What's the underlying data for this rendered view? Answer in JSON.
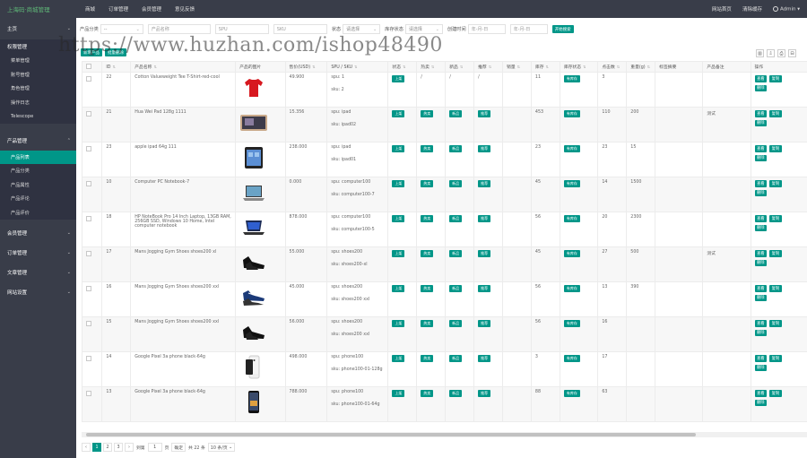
{
  "topbar": {
    "brand": "上海码·商城管理",
    "nav": [
      "商城",
      "订单管理",
      "会员管理",
      "意见反馈"
    ],
    "right": [
      "网站首页",
      "清除缓存"
    ],
    "user": "Admin"
  },
  "sidebar": {
    "home": "主页",
    "sec1": "权限管理",
    "sec1_items": [
      "菜单管理",
      "账号管理",
      "角色管理",
      "操作日志",
      "Telescope"
    ],
    "sec2": "产品管理",
    "sec2_items": [
      "产品列表",
      "产品分类",
      "产品属性",
      "产品评论",
      "产品评价"
    ],
    "sec3": "会员管理",
    "sec4": "订单管理",
    "sec5": "文章管理",
    "sec6": "网站设置"
  },
  "filter": {
    "cat_label": "产品分类",
    "cat_value": "--",
    "name_placeholder": "产品名称",
    "spu_placeholder": "SPU",
    "sku_placeholder": "SKU",
    "status_label": "状态",
    "status_value": "请选择",
    "stock_label": "库存状态",
    "stock_value": "请选择",
    "time_label": "创建时间",
    "from_placeholder": "年-月-日",
    "to_placeholder": "年-月-日",
    "search_btn": "开始搜索"
  },
  "actions": {
    "add": "新增产品",
    "batch": "批量删除"
  },
  "watermark": "https://www.huzhan.com/ishop48490",
  "table": {
    "headers": [
      "ID",
      "产品名称",
      "产品的图片",
      "售价(USD)",
      "SPU / SKU",
      "状态",
      "热卖",
      "新品",
      "推荐",
      "销量",
      "库存",
      "库存状态",
      "点击数",
      "重量(g)",
      "标签摘要",
      "产品备注",
      "操作"
    ],
    "rows": [
      {
        "id": "22",
        "name": "Cotton Valueweight Tee T-Shirt-red-cool",
        "pic": "tshirt",
        "price": "49.900",
        "spu": "spu: 1",
        "sku": "sku: 2",
        "status": "上架",
        "hot": "/",
        "new": "/",
        "rec": "/",
        "sales": "",
        "stock": "11",
        "stock_status": "有库存",
        "clicks": "3",
        "weight": "",
        "note": ""
      },
      {
        "id": "21",
        "name": "Hua Wei Pad 128g 1111",
        "pic": "tablet",
        "price": "15.356",
        "spu": "spu: ipad",
        "sku": "sku: ipad02",
        "status": "上架",
        "hot": "热卖",
        "new": "新品",
        "rec": "推荐",
        "sales": "",
        "stock": "453",
        "stock_status": "有库存",
        "clicks": "110",
        "weight": "200",
        "note": "测试"
      },
      {
        "id": "23",
        "name": "apple ipad 64g 111",
        "pic": "ipad",
        "price": "238.000",
        "spu": "spu: ipad",
        "sku": "sku: ipad01",
        "status": "上架",
        "hot": "热卖",
        "new": "新品",
        "rec": "推荐",
        "sales": "",
        "stock": "23",
        "stock_status": "有库存",
        "clicks": "23",
        "weight": "15",
        "note": ""
      },
      {
        "id": "10",
        "name": "Computer PC Notebook-7",
        "pic": "laptop",
        "price": "0.000",
        "spu": "spu: computer100",
        "sku": "sku: computer100-7",
        "status": "上架",
        "hot": "热卖",
        "new": "新品",
        "rec": "推荐",
        "sales": "",
        "stock": "45",
        "stock_status": "有库存",
        "clicks": "14",
        "weight": "1500",
        "note": ""
      },
      {
        "id": "18",
        "name": "HP NoteBook Pro 14 Inch Laptop, 13GB RAM, 256GB SSD, Windows 10 Home, Intel computer notebook",
        "pic": "laptop2",
        "price": "878.000",
        "spu": "spu: computer100",
        "sku": "sku: computer100-5",
        "status": "上架",
        "hot": "热卖",
        "new": "新品",
        "rec": "推荐",
        "sales": "",
        "stock": "56",
        "stock_status": "有库存",
        "clicks": "20",
        "weight": "2300",
        "note": ""
      },
      {
        "id": "17",
        "name": "Mans Jogging Gym Shoes shoes200 xl",
        "pic": "shoes",
        "price": "55.000",
        "spu": "spu: shoes200",
        "sku": "sku: shoes200-xl",
        "status": "上架",
        "hot": "热卖",
        "new": "新品",
        "rec": "推荐",
        "sales": "",
        "stock": "45",
        "stock_status": "有库存",
        "clicks": "27",
        "weight": "500",
        "note": "测试"
      },
      {
        "id": "16",
        "name": "Mans Jogging Gym Shoes shoes200 xxl",
        "pic": "shoes2",
        "price": "45.000",
        "spu": "spu: shoes200",
        "sku": "sku: shoes200 xxl",
        "status": "上架",
        "hot": "热卖",
        "new": "新品",
        "rec": "推荐",
        "sales": "",
        "stock": "56",
        "stock_status": "有库存",
        "clicks": "13",
        "weight": "390",
        "note": ""
      },
      {
        "id": "15",
        "name": "Mans Jogging Gym Shoes shoes200 xxl",
        "pic": "shoes",
        "price": "56.000",
        "spu": "spu: shoes200",
        "sku": "sku: shoes200 xxl",
        "status": "上架",
        "hot": "热卖",
        "new": "新品",
        "rec": "推荐",
        "sales": "",
        "stock": "56",
        "stock_status": "有库存",
        "clicks": "16",
        "weight": "",
        "note": ""
      },
      {
        "id": "14",
        "name": "Google Pixel 3a phone black-64g",
        "pic": "phone",
        "price": "498.000",
        "spu": "spu: phone100",
        "sku": "sku: phone100-01-128g",
        "status": "上架",
        "hot": "热卖",
        "new": "新品",
        "rec": "推荐",
        "sales": "",
        "stock": "3",
        "stock_status": "有库存",
        "clicks": "17",
        "weight": "",
        "note": ""
      },
      {
        "id": "13",
        "name": "Google Pixel 3a phone black-64g",
        "pic": "phone2",
        "price": "788.000",
        "spu": "spu: phone100",
        "sku": "sku: phone100-01-64g",
        "status": "上架",
        "hot": "热卖",
        "new": "新品",
        "rec": "推荐",
        "sales": "",
        "stock": "88",
        "stock_status": "有库存",
        "clicks": "63",
        "weight": "",
        "note": ""
      }
    ],
    "op_edit": "查看",
    "op_copy": "复制",
    "op_del": "删除"
  },
  "pager": {
    "pages": [
      "1",
      "2",
      "3"
    ],
    "goto_label": "到第",
    "goto_value": "1",
    "page_unit": "页",
    "confirm": "确定",
    "total": "共 22 条",
    "per_page": "10 条/页"
  }
}
